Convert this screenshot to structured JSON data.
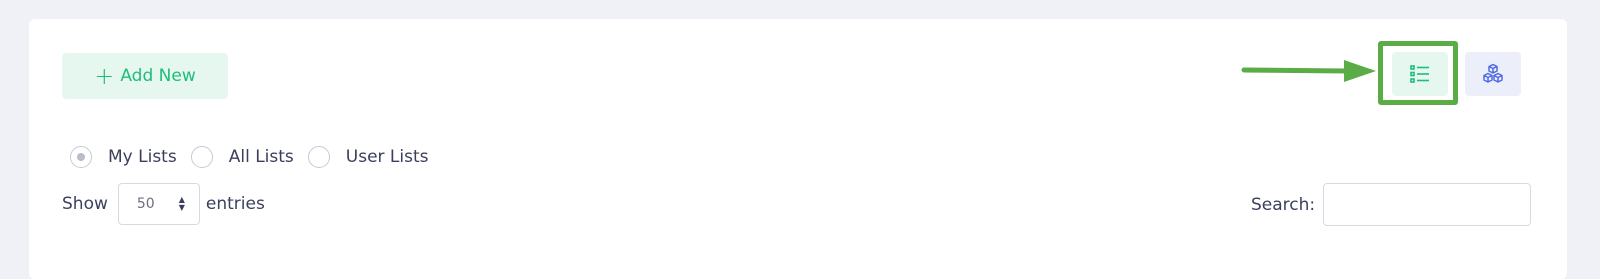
{
  "toolbar": {
    "add_new_label": "Add New",
    "add_new_icon": "plus-icon",
    "list_view_icon": "list-icon",
    "grid_view_icon": "cubes-icon",
    "accent_color": "#1fbd7b",
    "highlight_color": "#5aac47"
  },
  "filters": {
    "radios": [
      {
        "label": "My Lists",
        "checked": true
      },
      {
        "label": "All Lists",
        "checked": false
      },
      {
        "label": "User Lists",
        "checked": false
      }
    ]
  },
  "table_controls": {
    "show_label": "Show",
    "entries_value": "50",
    "entries_label": "entries",
    "search_label": "Search:",
    "search_value": ""
  }
}
